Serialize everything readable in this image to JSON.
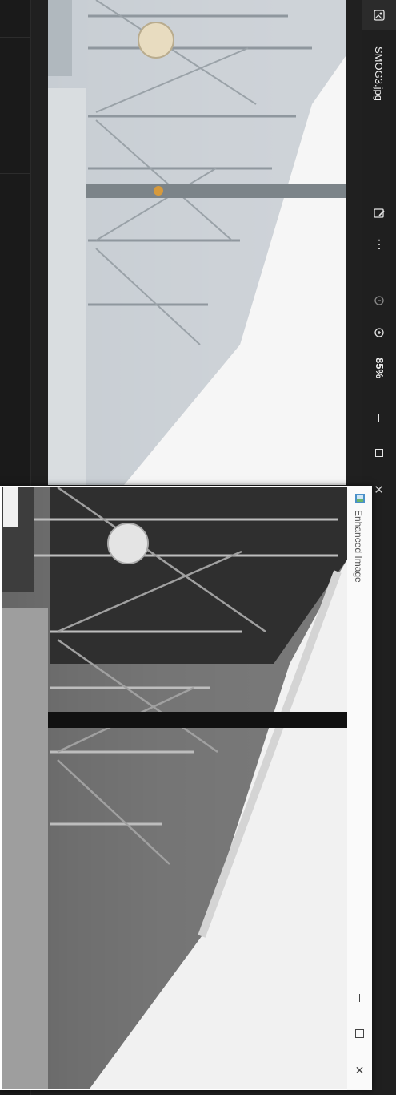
{
  "viewer": {
    "filename": "SMOG3.jpg",
    "zoom": "85%",
    "icons": [
      "gallery-icon",
      "edit-image-icon",
      "more-icon",
      "zoom-out-icon",
      "zoom-in-icon"
    ],
    "window_controls": [
      "minimize-icon",
      "maximize-icon",
      "close-icon"
    ]
  },
  "enhanced": {
    "title": "Enhanced Image",
    "window_controls": [
      "minimize-icon",
      "maximize-icon",
      "close-icon"
    ]
  },
  "colors": {
    "viewer_bg": "#202020",
    "dialog_bg": "#ffffff",
    "title_text": "#f0f0f0"
  }
}
